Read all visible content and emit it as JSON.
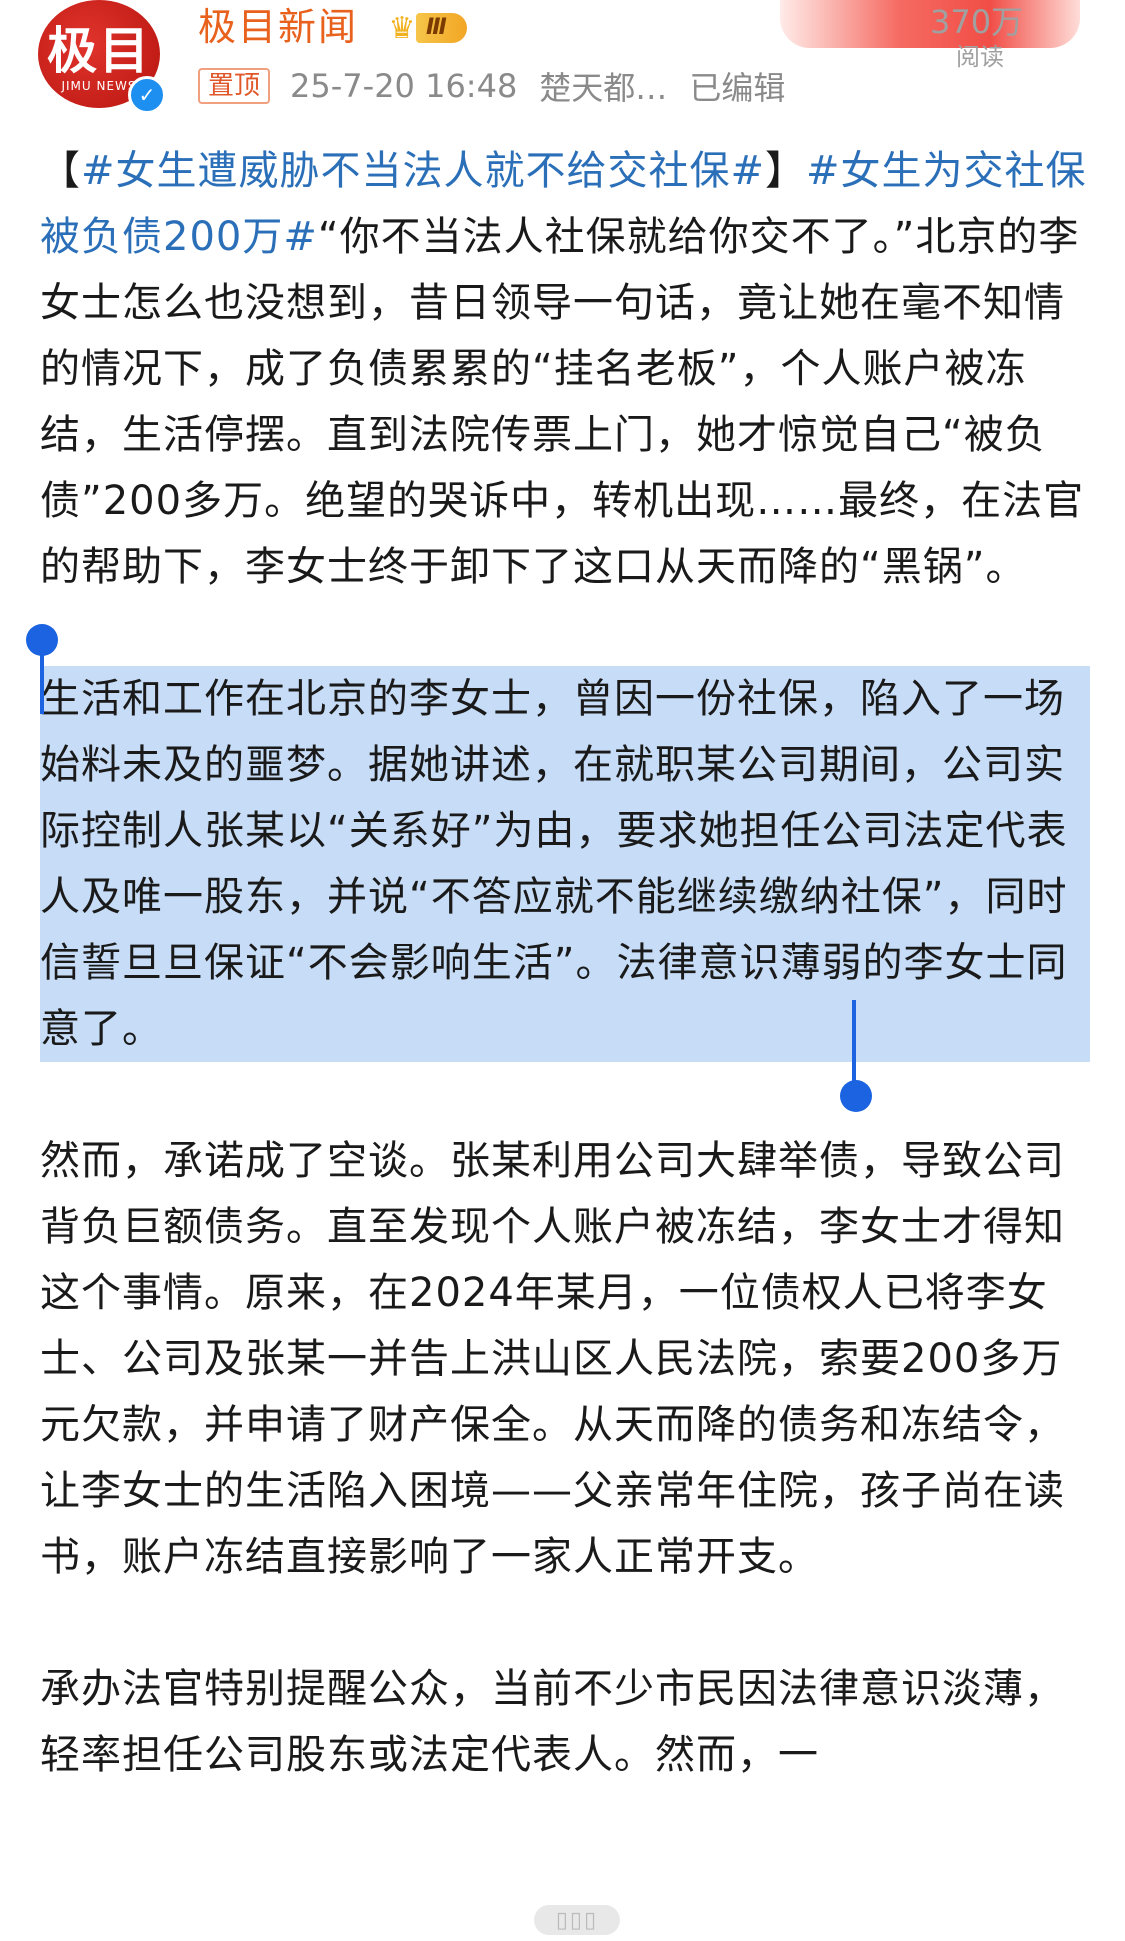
{
  "account": {
    "avatar_text": "极目",
    "avatar_subtext": "JIMU NEWS",
    "name": "极目新闻",
    "level_badge": "Ⅲ",
    "verified_icon": "check-icon"
  },
  "meta": {
    "pin_label": "置顶",
    "timestamp": "25-7-20 16:48",
    "location": "楚天都…",
    "edited_label": "已编辑"
  },
  "reads": {
    "count": "370万",
    "label": "阅读"
  },
  "post": {
    "hashtag1": "#女生遭威胁不当法人就不给交社保#",
    "bracket_open": "【",
    "bracket_close": "】",
    "hashtag2": "#女生为交社保被负债200万#",
    "intro": "“你不当法人社保就给你交不了。”北京的李女士怎么也没想到，昔日领导一句话，竟让她在毫不知情的情况下，成了负债累累的“挂名老板”，个人账户被冻结，生活停摆。直到法院传票上门，她才惊觉自己“被负债”200多万。绝望的哭诉中，转机出现……最终，在法官的帮助下，李女士终于卸下了这口从天而降的“黑锅”。",
    "para2": "生活和工作在北京的李女士，曾因一份社保，陷入了一场始料未及的噩梦。据她讲述，在就职某公司期间，公司实际控制人张某以“关系好”为由，要求她担任公司法定代表人及唯一股东，并说“不答应就不能继续缴纳社保”，同时信誓旦旦保证“不会影响生活”。法律意识薄弱的李女士同意了。",
    "para3": "然而，承诺成了空谈。张某利用公司大肆举债，导致公司背负巨额债务。直至发现个人账户被冻结，李女士才得知这个事情。原来，在2024年某月，一位债权人已将李女士、公司及张某一并告上洪山区人民法院，索要200多万元欠款，并申请了财产保全。从天而降的债务和冻结令，让李女士的生活陷入困境——父亲常年住院，孩子尚在读书，账户冻结直接影响了一家人正常开支。",
    "para4": "承办法官特别提醒公众，当前不少市民因法律意识淡薄，轻率担任公司股东或法定代表人。然而，一"
  },
  "colors": {
    "accent_orange": "#e8611d",
    "hashtag_blue": "#2a6fb8",
    "selection_bg": "#c7dcf6",
    "selection_handle": "#1b63e0"
  }
}
